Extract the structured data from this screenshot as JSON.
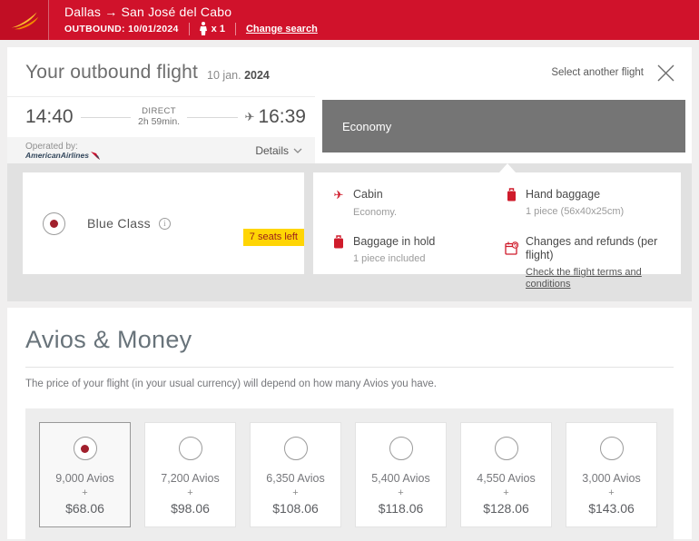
{
  "header": {
    "route": "Dallas → San José del Cabo",
    "outbound_label": "OUTBOUND: 10/01/2024",
    "passengers": "x 1",
    "change_search": "Change search"
  },
  "outbound": {
    "title": "Your outbound flight",
    "date_day": "10 jan.",
    "date_year": "2024",
    "select_another": "Select another flight",
    "departure_time": "14:40",
    "direct_label": "DIRECT",
    "duration": "2h 59min.",
    "arrival_time": "16:39",
    "operated_by": "Operated by:",
    "operator": "AmericanAirlines",
    "details_label": "Details",
    "cabin_tab": "Economy"
  },
  "fare": {
    "name": "Blue Class",
    "info_glyph": "i",
    "seats_left": "7 seats left",
    "details": [
      {
        "icon": "plane-icon",
        "title": "Cabin",
        "sub": "Economy."
      },
      {
        "icon": "hand-baggage-icon",
        "title": "Hand baggage",
        "sub": "1 piece (56x40x25cm)"
      },
      {
        "icon": "hold-baggage-icon",
        "title": "Baggage in hold",
        "sub": "1 piece included"
      },
      {
        "icon": "calendar-refund-icon",
        "title": "Changes and refunds (per flight)",
        "link": "Check the flight terms and conditions"
      }
    ]
  },
  "avios": {
    "title": "Avios & Money",
    "description": "The price of your flight (in your usual currency) will depend on how many Avios you have.",
    "plus": "+",
    "options": [
      {
        "avios": "9,000 Avios",
        "price": "$68.06",
        "selected": true
      },
      {
        "avios": "7,200 Avios",
        "price": "$98.06",
        "selected": false
      },
      {
        "avios": "6,350 Avios",
        "price": "$108.06",
        "selected": false
      },
      {
        "avios": "5,400 Avios",
        "price": "$118.06",
        "selected": false
      },
      {
        "avios": "4,550 Avios",
        "price": "$128.06",
        "selected": false
      },
      {
        "avios": "3,000 Avios",
        "price": "$143.06",
        "selected": false
      }
    ]
  },
  "colors": {
    "header_red": "#d0122b",
    "logo_red": "#c10e24",
    "economy_gray": "#757575",
    "badge_yellow": "#ffd504",
    "badge_text": "#9a1c1c",
    "accent_icon_red": "#cf1b2b",
    "radio_dot_red": "#a1202d",
    "band_gray": "#e1e1e1"
  }
}
